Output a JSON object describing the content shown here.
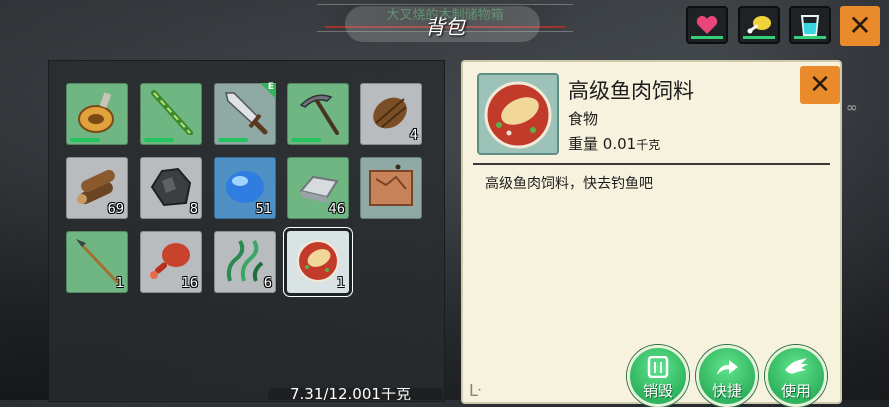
{
  "header": {
    "title": "背包",
    "ghost_text": "大叉烧的木制储物箱"
  },
  "status_buttons": [
    {
      "name": "health-button",
      "icon": "heart-icon",
      "color": "#e8467a"
    },
    {
      "name": "food-button",
      "icon": "drumstick-icon",
      "color": "#f0d23a"
    },
    {
      "name": "water-button",
      "icon": "water-cup-icon",
      "color": "#3ad6e0"
    }
  ],
  "close_label": "✕",
  "inventory": {
    "slots": [
      {
        "item": "gourd-flask",
        "qty": "",
        "bg": "green",
        "durability": true
      },
      {
        "item": "bamboo-staff",
        "qty": "",
        "bg": "green",
        "durability": true
      },
      {
        "item": "iron-sword",
        "qty": "",
        "bg": "tan",
        "durability": true,
        "badge": "E"
      },
      {
        "item": "pickaxe",
        "qty": "",
        "bg": "green",
        "durability": true
      },
      {
        "item": "bark-bundle",
        "qty": "4",
        "bg": "gray"
      },
      {
        "item": "logs",
        "qty": "69",
        "bg": "gray"
      },
      {
        "item": "coal-ore",
        "qty": "8",
        "bg": "gray"
      },
      {
        "item": "blue-crystal",
        "qty": "51",
        "bg": "blue"
      },
      {
        "item": "iron-ingot",
        "qty": "46",
        "bg": "green"
      },
      {
        "item": "treasure-map",
        "qty": "",
        "bg": "tan"
      },
      {
        "item": "spear",
        "qty": "1",
        "bg": "green"
      },
      {
        "item": "meat-leg",
        "qty": "16",
        "bg": "gray"
      },
      {
        "item": "seaweed",
        "qty": "6",
        "bg": "gray"
      },
      {
        "item": "fish-feed",
        "qty": "1",
        "bg": "selected"
      }
    ],
    "weight_text": "7.31/12.001千克"
  },
  "detail": {
    "name": "高级鱼肉饲料",
    "category": "食物",
    "weight_label": "重量",
    "weight_value": "0.01",
    "weight_unit": "千克",
    "description": "高级鱼肉饲料，快去钓鱼吧",
    "actions": [
      {
        "label": "销毁",
        "icon": "trash-icon"
      },
      {
        "label": "快捷",
        "icon": "share-arrow-icon"
      },
      {
        "label": "使用",
        "icon": "hand-icon"
      }
    ]
  },
  "colors": {
    "accent": "#e98b2a",
    "green": "#6fb683",
    "action_green": "#2fb35e",
    "panel": "#f6f2dd"
  }
}
